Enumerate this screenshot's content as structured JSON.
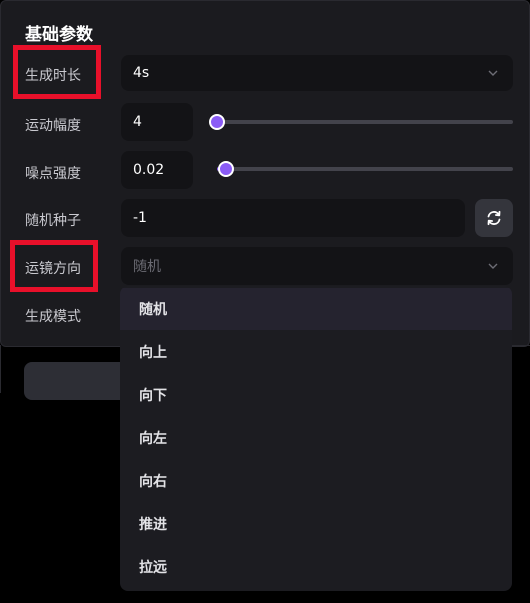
{
  "panel": {
    "title": "基础参数"
  },
  "params": {
    "duration": {
      "label": "生成时长",
      "value": "4s"
    },
    "motion": {
      "label": "运动幅度",
      "value": "4",
      "slider_fraction": 0.0
    },
    "noise": {
      "label": "噪点强度",
      "value": "0.02",
      "slider_fraction": 0.04
    },
    "seed": {
      "label": "随机种子",
      "value": "-1"
    },
    "camera": {
      "label": "运镜方向",
      "placeholder": "随机"
    },
    "mode": {
      "label": "生成模式"
    }
  },
  "dropdown": {
    "options": [
      "随机",
      "向上",
      "向下",
      "向左",
      "向右",
      "推进",
      "拉远"
    ],
    "selected": "随机"
  },
  "icons": {
    "chevron": "chevron-down-icon",
    "refresh": "refresh-icon"
  },
  "colors": {
    "accent": "#8b5cf6",
    "highlight": "#e8102a"
  }
}
